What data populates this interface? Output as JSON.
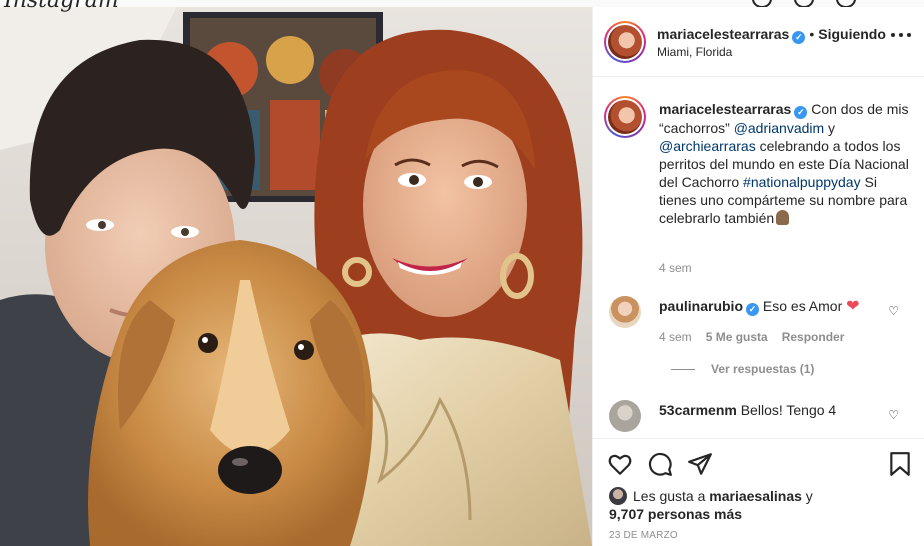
{
  "header": {
    "username": "mariacelestearraras",
    "separator": "•",
    "follow_status": "Siguiendo",
    "location": "Miami, Florida",
    "verified_mark": "✓",
    "more_icon": "more-horizontal-icon"
  },
  "caption": {
    "username": "mariacelestearraras",
    "text_1": "Con dos de mis “cachorros” ",
    "mention_1": "@adrianvadim",
    "text_2": " y ",
    "mention_2": "@archiearraras",
    "text_3": " celebrando a todos los perritos del mundo en este Día Nacional del Cachorro ",
    "hashtag": "#nationalpuppyday",
    "text_4": " Si tienes uno compárteme su nombre para celebrarlo también",
    "time": "4 sem"
  },
  "comments": [
    {
      "username": "paulinarubio",
      "text": "Eso es Amor",
      "emoji": "❤",
      "time": "4 sem",
      "likes": "5 Me gusta",
      "reply": "Responder",
      "view_replies": "Ver respuestas (1)"
    },
    {
      "username": "53carmenm",
      "text": "Bellos! Tengo 4"
    }
  ],
  "likes": {
    "prefix": "Les gusta a ",
    "user": "mariaesalinas",
    "conjunction": " y",
    "count": "9,707 personas más"
  },
  "date": "23 DE MARZO",
  "colors": {
    "verified": "#3897f0",
    "heart": "#ed4956",
    "mention": "#00376b",
    "meta": "#8e8e8e"
  }
}
